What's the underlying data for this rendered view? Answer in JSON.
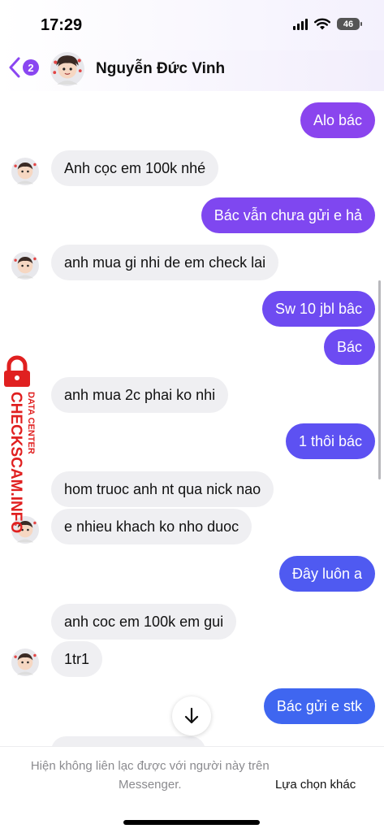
{
  "status_bar": {
    "time": "17:29",
    "battery": "46"
  },
  "header": {
    "back_count": "2",
    "contact_name": "Nguyễn Đức Vinh"
  },
  "colors": {
    "accent": "#8a46f1",
    "incoming_bubble": "#efeff2"
  },
  "messages": [
    {
      "text": "Alo bác",
      "side": "out",
      "color": "#8a45ee"
    },
    {
      "text": "Anh cọc em 100k nhé",
      "side": "in",
      "avatar": true
    },
    {
      "text": "Bác vẫn chưa gửi e hả",
      "side": "out",
      "color": "#7f47f0"
    },
    {
      "text": "anh mua gi nhi de em check lai",
      "side": "in",
      "avatar": true
    },
    {
      "text": "Sw 10 jbl bâc",
      "side": "out",
      "color": "#6e4bf1"
    },
    {
      "text": "Bác",
      "side": "out",
      "color": "#6d4bf2"
    },
    {
      "text": "anh mua 2c phai ko nhi",
      "side": "in",
      "avatar": false
    },
    {
      "text": "1 thôi bác",
      "side": "out",
      "color": "#5d51f2"
    },
    {
      "text": "hom truoc anh nt qua nick nao",
      "side": "in",
      "avatar": false
    },
    {
      "text": "e nhieu khach ko nho duoc",
      "side": "in",
      "avatar": true
    },
    {
      "text": "Đây luôn a",
      "side": "out",
      "color": "#4f5af1"
    },
    {
      "text": "anh coc em 100k em gui",
      "side": "in",
      "avatar": false
    },
    {
      "text": "1tr1",
      "side": "in",
      "avatar": true
    },
    {
      "text": "Bác gửi e stk",
      "side": "out",
      "color": "#3f66f0"
    }
  ],
  "watermark": {
    "brand": "CHECKSCAM.INFO",
    "sub": "DATA CENTER"
  },
  "footer": {
    "notice": "Hiện không liên lạc được với người này trên Messenger.",
    "link": "Lựa chọn khác"
  },
  "icons": {
    "back": "chevron-left-icon",
    "scroll_down": "arrow-down-icon"
  }
}
